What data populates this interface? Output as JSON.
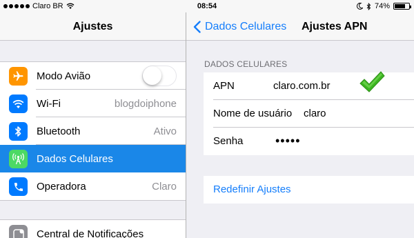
{
  "status_bar": {
    "carrier": "Claro BR",
    "time": "08:54",
    "battery_text": "74%",
    "battery_level": 0.74,
    "icons": [
      "signal-dots-icon",
      "wifi-icon",
      "moon-icon",
      "bluetooth-icon",
      "battery-icon"
    ]
  },
  "left_pane": {
    "title": "Ajustes",
    "items": [
      {
        "label": "Modo Avião",
        "icon": "airplane-icon",
        "icon_color": "#ff9500",
        "control": "toggle",
        "toggle_on": false
      },
      {
        "label": "Wi-Fi",
        "value": "blogdoiphone",
        "icon": "wifi-icon",
        "icon_color": "#007aff"
      },
      {
        "label": "Bluetooth",
        "value": "Ativo",
        "icon": "bluetooth-icon",
        "icon_color": "#007aff"
      },
      {
        "label": "Dados Celulares",
        "icon": "antenna-icon",
        "icon_color": "#4cd964",
        "selected": true
      },
      {
        "label": "Operadora",
        "value": "Claro",
        "icon": "phone-icon",
        "icon_color": "#007aff"
      }
    ],
    "second_group": [
      {
        "label": "Central de Notificações",
        "icon": "notifications-icon",
        "icon_color": "#8e8e93"
      }
    ]
  },
  "right_pane": {
    "back_label": "Dados Celulares",
    "title": "Ajustes APN",
    "section_header": "DADOS CELULARES",
    "fields": {
      "apn": {
        "label": "APN",
        "value": "claro.com.br"
      },
      "username": {
        "label": "Nome de usuário",
        "value": "claro"
      },
      "password": {
        "label": "Senha",
        "value": "•••••"
      }
    },
    "reset_label": "Redefinir Ajustes",
    "accent_color": "#157efb",
    "checkmark_color": "#3cb521"
  }
}
